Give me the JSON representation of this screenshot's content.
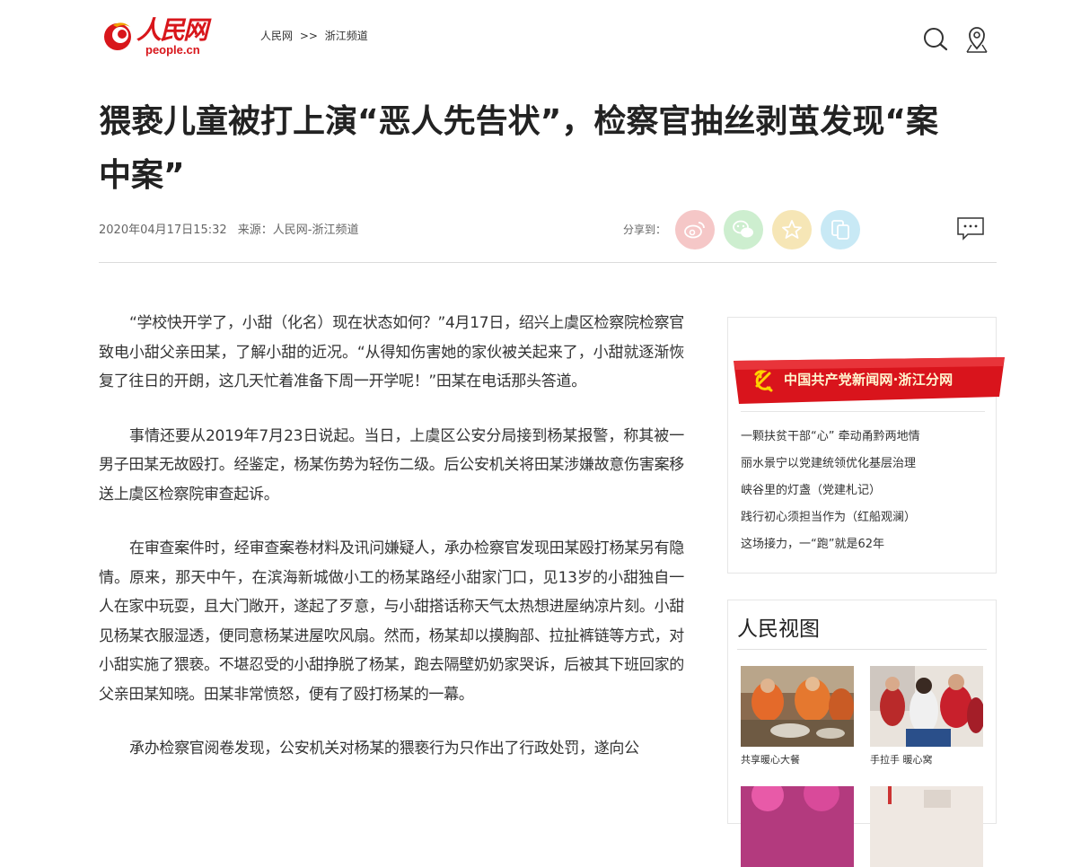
{
  "header": {
    "logo_cn": "人民网",
    "logo_en": "people.cn",
    "breadcrumb": [
      "人民网",
      ">>",
      "浙江频道"
    ],
    "icons": [
      "search-icon",
      "location-icon"
    ]
  },
  "article": {
    "title": "猥亵儿童被打上演“恶人先告状”，检察官抽丝剥茧发现“案中案”",
    "date": "2020年04月17日15:32",
    "source": "来源：人民网-浙江频道",
    "share_label": "分享到：",
    "share_icons": [
      "weibo-icon",
      "wechat-icon",
      "favorite-icon",
      "copy-icon"
    ],
    "paragraphs": [
      "“学校快开学了，小甜（化名）现在状态如何？”4月17日，绍兴上虞区检察院检察官致电小甜父亲田某，了解小甜的近况。“从得知伤害她的家伙被关起来了，小甜就逐渐恢复了往日的开朗，这几天忙着准备下周一开学呢！”田某在电话那头答道。",
      "事情还要从2019年7月23日说起。当日，上虞区公安分局接到杨某报警，称其被一男子田某无故殴打。经鉴定，杨某伤势为轻伤二级。后公安机关将田某涉嫌故意伤害案移送上虞区检察院审查起诉。",
      "在审查案件时，经审查案卷材料及讯问嫌疑人，承办检察官发现田某殴打杨某另有隐情。原来，那天中午，在滨海新城做小工的杨某路经小甜家门口，见13岁的小甜独自一人在家中玩耍，且大门敞开，遂起了歹意，与小甜搭话称天气太热想进屋纳凉片刻。小甜见杨某衣服湿透，便同意杨某进屋吹风扇。然而，杨某却以摸胸部、拉扯裤链等方式，对小甜实施了猥亵。不堪忍受的小甜挣脱了杨某，跑去隔壁奶奶家哭诉，后被其下班回家的父亲田某知晓。田某非常愤怒，便有了殴打杨某的一幕。",
      "承办检察官阅卷发现，公安机关对杨某的猥亵行为只作出了行政处罚，遂向公"
    ]
  },
  "sidebar": {
    "party_banner": "中国共产党新闻网·浙江分网",
    "party_links": [
      "一颗扶贫干部“心” 牵动甬黔两地情",
      "丽水景宁以党建统领优化基层治理",
      "峡谷里的灯盏（党建札记）",
      "践行初心须担当作为（红船观澜）",
      "这场接力，一“跑”就是62年"
    ],
    "photo_heading": "人民视图",
    "photos": [
      {
        "caption": "共享暖心大餐"
      },
      {
        "caption": "手拉手 暖心窝"
      }
    ]
  },
  "colors": {
    "brand_red": "#d8161b",
    "weibo": "#f5c7c7",
    "wechat": "#cdeecf",
    "favorite": "#f6e6b6",
    "copy": "#c8e9f5"
  }
}
